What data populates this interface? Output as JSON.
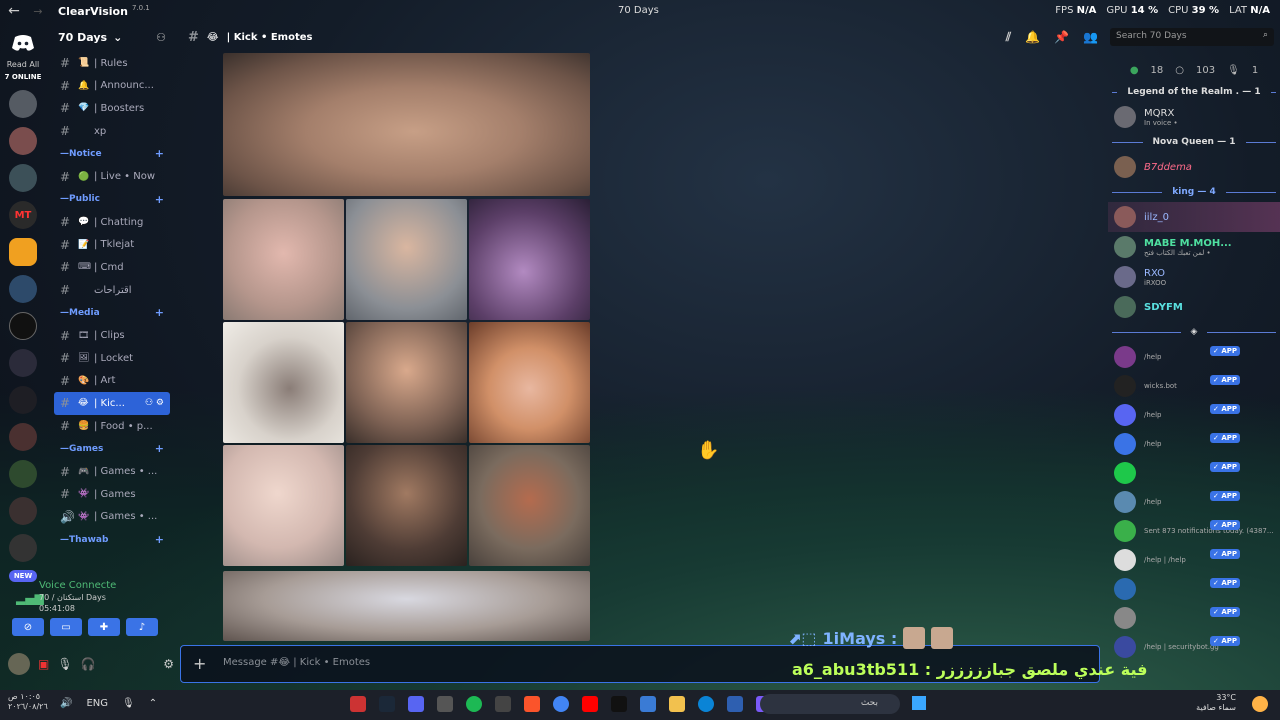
{
  "app": {
    "name": "ClearVision",
    "version": "7.0.1",
    "window_title": "70 Days",
    "back": "←",
    "forward": "→"
  },
  "stats": {
    "fps_label": "FPS",
    "fps": "N/A",
    "gpu_label": "GPU",
    "gpu": "14 %",
    "cpu_label": "CPU",
    "cpu": "39 %",
    "lat_label": "LAT",
    "lat": "N/A"
  },
  "servers": {
    "read_all": "Read All",
    "online": "7 ONLINE",
    "new": "NEW",
    "badges": [
      "11",
      "1",
      "3"
    ]
  },
  "server": {
    "name": "70 Days"
  },
  "channels": [
    {
      "type": "ch",
      "emoji": "📜",
      "name": "| Rules"
    },
    {
      "type": "ch",
      "emoji": "🔔",
      "name": "| Announc..."
    },
    {
      "type": "ch",
      "emoji": "💎",
      "name": "| Boosters"
    },
    {
      "type": "ch",
      "emoji": "",
      "name": "xp"
    },
    {
      "type": "cat",
      "name": "Notice"
    },
    {
      "type": "ch",
      "emoji": "🟢",
      "name": "| Live • Now"
    },
    {
      "type": "cat",
      "name": "Public"
    },
    {
      "type": "ch",
      "emoji": "💬",
      "name": "| Chatting"
    },
    {
      "type": "ch",
      "emoji": "📝",
      "name": "| Tklejat"
    },
    {
      "type": "ch",
      "emoji": "⌨",
      "name": "| Cmd"
    },
    {
      "type": "ch",
      "emoji": "",
      "name": "اقتراحات"
    },
    {
      "type": "cat",
      "name": "Media"
    },
    {
      "type": "ch",
      "emoji": "🎞",
      "name": "| Clips"
    },
    {
      "type": "ch",
      "emoji": "🖼",
      "name": "| Locket"
    },
    {
      "type": "ch",
      "emoji": "🎨",
      "name": "| Art"
    },
    {
      "type": "ch",
      "emoji": "😂",
      "name": "| Kic...",
      "active": true
    },
    {
      "type": "ch",
      "emoji": "🍔",
      "name": "| Food • p..."
    },
    {
      "type": "cat",
      "name": "Games"
    },
    {
      "type": "ch",
      "emoji": "🎮",
      "name": "| Games • ..."
    },
    {
      "type": "ch",
      "emoji": "👾",
      "name": "| Games"
    },
    {
      "type": "ch",
      "emoji": "👾",
      "name": "| Games • ...",
      "voice": true
    },
    {
      "type": "cat",
      "name": "Thawab"
    }
  ],
  "voice": {
    "title": "Voice Connecte",
    "sub": "70 / استكنان Days",
    "time": "05:41:08"
  },
  "channel_header": {
    "name": "| Kick • Emotes",
    "emoji": "😂"
  },
  "search": {
    "placeholder": "Search 70 Days"
  },
  "members": {
    "counts": {
      "online": "18",
      "idle": "103",
      "voice": "1"
    },
    "roles": [
      {
        "name": "Legend of the Realm . — 1",
        "members": [
          {
            "name": "MQRX",
            "sub": "In voice •",
            "cls": ""
          }
        ]
      },
      {
        "name": "Nova Queen — 1",
        "members": [
          {
            "name": "B7ddema",
            "sub": "",
            "cls": "r"
          }
        ]
      },
      {
        "name": "king — 4",
        "members": [
          {
            "name": "iilz_0",
            "sub": "",
            "cls": "k",
            "hl": true
          },
          {
            "name": "MABE M.MOH...",
            "sub": "لمن تعبك الكتاب فتح •",
            "cls": "t"
          },
          {
            "name": "RXO",
            "sub": "iRXOO",
            "cls": "k"
          },
          {
            "name": "SDYFM",
            "sub": "",
            "cls": "c"
          }
        ]
      }
    ],
    "bots": [
      {
        "name": "",
        "sub": "/help",
        "badge": "✓ APP"
      },
      {
        "name": "",
        "sub": "wicks.bot",
        "badge": "✓ APP"
      },
      {
        "name": "",
        "sub": "/help",
        "badge": "✓ APP"
      },
      {
        "name": "",
        "sub": "/help",
        "badge": "✓ APP"
      },
      {
        "name": "",
        "sub": "",
        "badge": "✓ APP"
      },
      {
        "name": "",
        "sub": "/help",
        "badge": "✓ APP"
      },
      {
        "name": "",
        "sub": "Sent 873 notifications today. (4387...",
        "badge": "✓ APP"
      },
      {
        "name": "",
        "sub": "/help | /help",
        "badge": "✓ APP"
      },
      {
        "name": "",
        "sub": "",
        "badge": "✓ APP"
      },
      {
        "name": "",
        "sub": "",
        "badge": "✓ APP"
      },
      {
        "name": "",
        "sub": "/help | securitybot.gg",
        "badge": "✓ APP"
      }
    ]
  },
  "message": {
    "placeholder": "Message #😂 | Kick • Emotes"
  },
  "overlay": {
    "line1": "1iMays :",
    "line2": "a6_abu3tb511 : فية عندي ملصق جبازززززر"
  },
  "taskbar": {
    "time": "١٠:٠٥ ص",
    "date": "٢٠٢٦/٠٨/٢٦",
    "lang": "ENG",
    "search": "بحث",
    "temp": "33°C",
    "weather": "سماء صافية"
  }
}
